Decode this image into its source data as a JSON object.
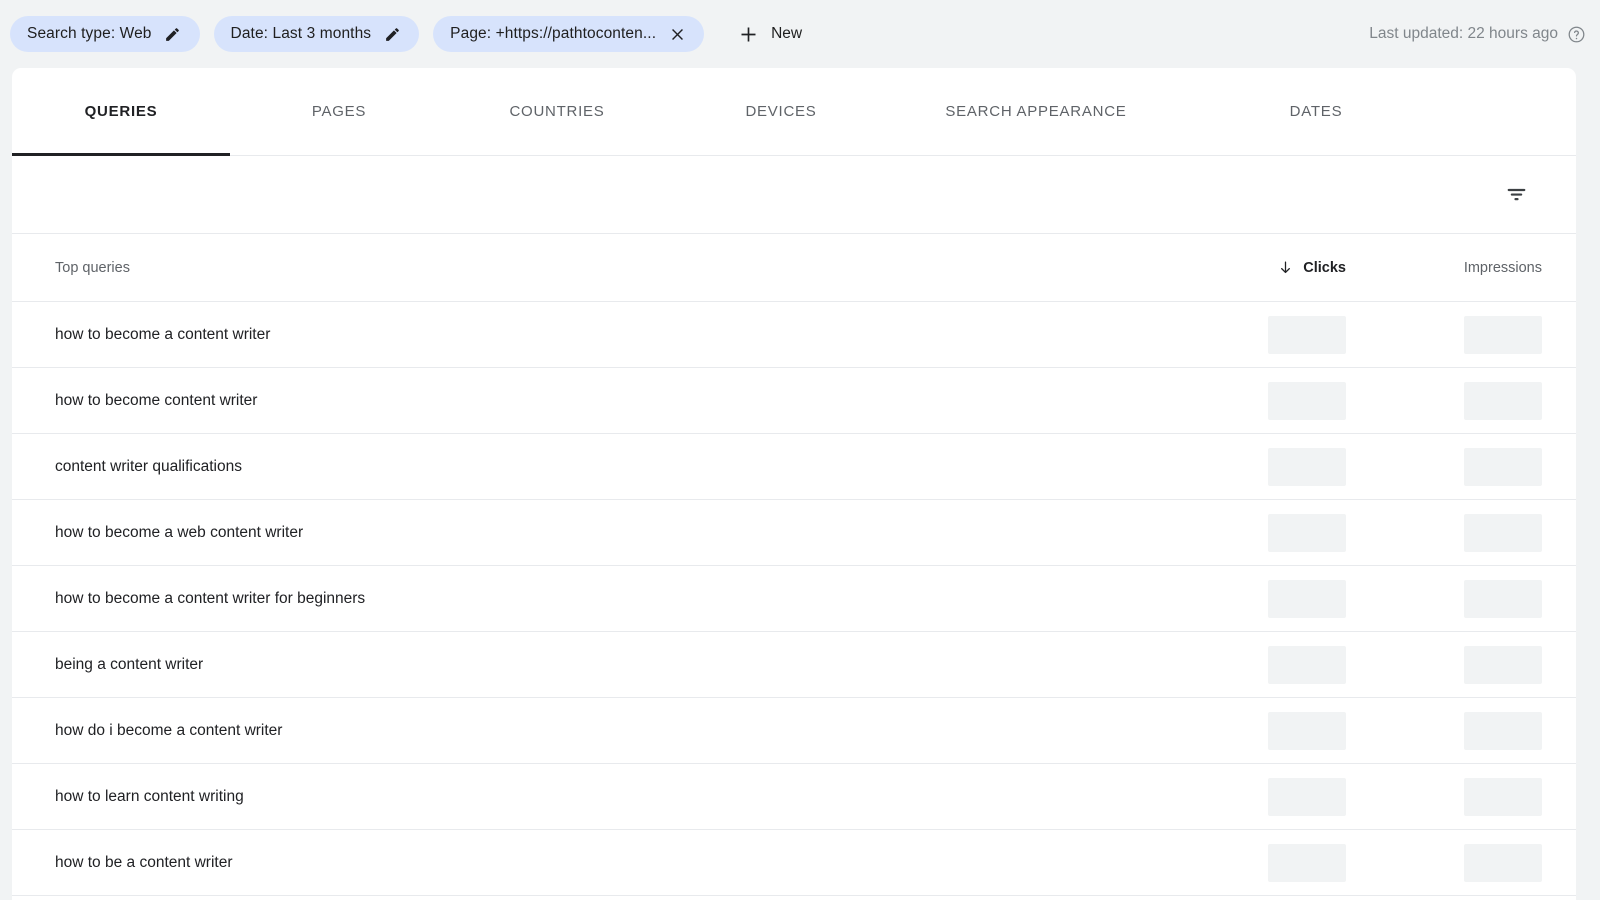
{
  "filter_bar": {
    "chips": [
      {
        "label": "Search type: Web",
        "action_icon": "pencil-icon",
        "action": "edit"
      },
      {
        "label": "Date: Last 3 months",
        "action_icon": "pencil-icon",
        "action": "edit"
      },
      {
        "label": "Page: +https://pathtoconten...",
        "action_icon": "close-icon",
        "action": "remove"
      }
    ],
    "new_button": {
      "label": "New",
      "icon": "plus-icon"
    },
    "last_updated": "Last updated: 22 hours ago",
    "help_icon": "help-circle-icon"
  },
  "tabs": [
    {
      "label": "QUERIES",
      "active": true
    },
    {
      "label": "PAGES",
      "active": false
    },
    {
      "label": "COUNTRIES",
      "active": false
    },
    {
      "label": "DEVICES",
      "active": false
    },
    {
      "label": "SEARCH APPEARANCE",
      "active": false
    },
    {
      "label": "DATES",
      "active": false
    }
  ],
  "toolbar": {
    "filter_icon": "filter-list-icon"
  },
  "table": {
    "columns": {
      "query": "Top queries",
      "clicks": "Clicks",
      "impressions": "Impressions"
    },
    "sort": {
      "column": "Clicks",
      "direction": "descending",
      "arrow": "arrow-down-icon"
    },
    "rows": [
      {
        "query": "how to become a content writer",
        "clicks": "",
        "impressions": ""
      },
      {
        "query": "how to become content writer",
        "clicks": "",
        "impressions": ""
      },
      {
        "query": "content writer qualifications",
        "clicks": "",
        "impressions": ""
      },
      {
        "query": "how to become a web content writer",
        "clicks": "",
        "impressions": ""
      },
      {
        "query": "how to become a content writer for beginners",
        "clicks": "",
        "impressions": ""
      },
      {
        "query": "being a content writer",
        "clicks": "",
        "impressions": ""
      },
      {
        "query": "how do i become a content writer",
        "clicks": "",
        "impressions": ""
      },
      {
        "query": "how to learn content writing",
        "clicks": "",
        "impressions": ""
      },
      {
        "query": "how to be a content writer",
        "clicks": "",
        "impressions": ""
      }
    ]
  },
  "colors": {
    "chip_background": "#d7e3fc",
    "page_background": "#f1f3f4",
    "card_background": "#ffffff",
    "text_primary": "#202124",
    "text_secondary": "#5f6368",
    "muted_text": "#80868b",
    "divider": "#e8eaed",
    "skeleton": "#f1f3f4"
  }
}
